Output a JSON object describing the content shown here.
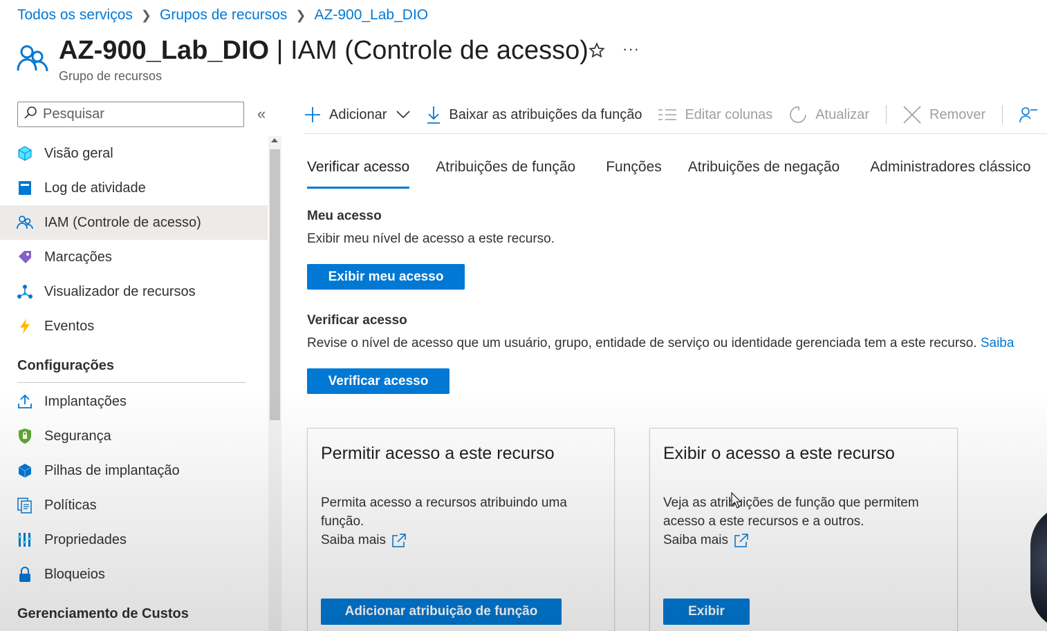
{
  "breadcrumb": [
    "Todos os serviços",
    "Grupos de recursos",
    "AZ-900_Lab_DIO"
  ],
  "header": {
    "resource_name": "AZ-900_Lab_DIO",
    "separator": " | ",
    "page_name": "IAM (Controle de acesso)",
    "subtitle": "Grupo de recursos",
    "more": "···"
  },
  "sidebar": {
    "search_placeholder": "Pesquisar",
    "items": [
      {
        "label": "Visão geral",
        "icon": "cube-icon"
      },
      {
        "label": "Log de atividade",
        "icon": "book-icon"
      },
      {
        "label": "IAM (Controle de acesso)",
        "icon": "people-icon",
        "active": true
      },
      {
        "label": "Marcações",
        "icon": "tag-icon"
      },
      {
        "label": "Visualizador de recursos",
        "icon": "hierarchy-icon"
      },
      {
        "label": "Eventos",
        "icon": "lightning-icon"
      }
    ],
    "section_config": "Configurações",
    "config_items": [
      {
        "label": "Implantações",
        "icon": "upload-icon"
      },
      {
        "label": "Segurança",
        "icon": "shield-icon"
      },
      {
        "label": "Pilhas de implantação",
        "icon": "stack-icon"
      },
      {
        "label": "Políticas",
        "icon": "policy-icon"
      },
      {
        "label": "Propriedades",
        "icon": "properties-icon"
      },
      {
        "label": "Bloqueios",
        "icon": "lock-icon"
      }
    ],
    "section_costs": "Gerenciamento de Custos"
  },
  "toolbar": {
    "add": "Adicionar",
    "download": "Baixar as atribuições da função",
    "edit_columns": "Editar colunas",
    "refresh": "Atualizar",
    "remove": "Remover"
  },
  "tabs": [
    "Verificar acesso",
    "Atribuições de função",
    "Funções",
    "Atribuições de negação",
    "Administradores clássico"
  ],
  "my_access": {
    "heading": "Meu acesso",
    "description": "Exibir meu nível de acesso a este recurso.",
    "button": "Exibir meu acesso"
  },
  "check_access": {
    "heading": "Verificar acesso",
    "description": "Revise o nível de acesso que um usuário, grupo, entidade de serviço ou identidade gerenciada tem a este recurso.",
    "link": "Saiba",
    "button": "Verificar acesso"
  },
  "cards": [
    {
      "title": "Permitir acesso a este recurso",
      "text": "Permita acesso a recursos atribuindo uma função.",
      "link": "Saiba mais",
      "button": "Adicionar atribuição de função"
    },
    {
      "title": "Exibir o acesso a este recurso",
      "text": "Veja as atribuições de função que permitem acesso a este recursos e a outros.",
      "link": "Saiba mais",
      "button": "Exibir"
    }
  ],
  "colors": {
    "accent": "#0078d4",
    "text": "#323130",
    "muted": "#605e5c",
    "active_nav": "#edebe9"
  }
}
